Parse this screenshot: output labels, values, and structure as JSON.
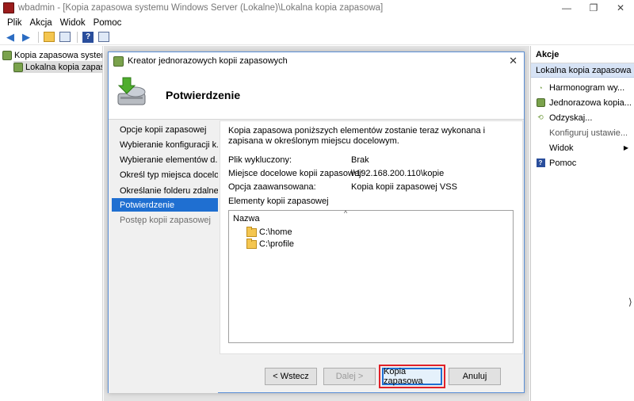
{
  "window": {
    "title": "wbadmin - [Kopia zapasowa systemu Windows Server (Lokalne)\\Lokalna kopia zapasowa]",
    "minimize": "—",
    "maximize": "❐",
    "close": "✕"
  },
  "menu": [
    "Plik",
    "Akcja",
    "Widok",
    "Pomoc"
  ],
  "tree": {
    "root": "Kopia zapasowa systemu W",
    "child": "Lokalna kopia zapasowa"
  },
  "actions": {
    "header": "Akcje",
    "section": "Lokalna kopia zapasowa",
    "items": [
      {
        "label": "Harmonogram wy...",
        "icon": "schedule-icon"
      },
      {
        "label": "Jednorazowa kopia...",
        "icon": "backup-once-icon"
      },
      {
        "label": "Odzyskaj...",
        "icon": "recover-icon"
      },
      {
        "label": "Konfiguruj ustawie...",
        "icon": ""
      },
      {
        "label": "Widok",
        "icon": ""
      },
      {
        "label": "Pomoc",
        "icon": "help-icon"
      }
    ]
  },
  "dialog": {
    "title": "Kreator jednorazowych kopii zapasowych",
    "heading": "Potwierdzenie",
    "steps": [
      "Opcje kopii zapasowej",
      "Wybieranie konfiguracji k...",
      "Wybieranie elementów d...",
      "Określ typ miejsca docelo...",
      "Określanie folderu zdalne...",
      "Potwierdzenie",
      "Postęp kopii zapasowej"
    ],
    "intro": "Kopia zapasowa poniższych elementów zostanie teraz wykonana i zapisana w określonym miejscu docelowym.",
    "excluded_label": "Plik wykluczony:",
    "excluded_value": "Brak",
    "dest_label": "Miejsce docelowe kopii zapasowej:",
    "dest_value": "\\\\192.168.200.110\\kopie",
    "advanced_label": "Opcja zaawansowana:",
    "advanced_value": "Kopia kopii zapasowej VSS",
    "items_label": "Elementy kopii zapasowej",
    "list_header": "Nazwa",
    "list_items": [
      "C:\\home",
      "C:\\profile"
    ],
    "buttons": {
      "back": "< Wstecz",
      "next": "Dalej >",
      "backup": "Kopia zapasowa",
      "cancel": "Anuluj"
    }
  }
}
